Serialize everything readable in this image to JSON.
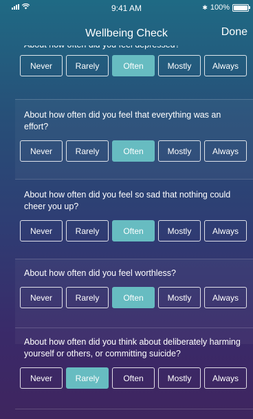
{
  "status_bar": {
    "time": "9:41 AM",
    "battery_text": "100%",
    "bluetooth_symbol": "✱"
  },
  "nav": {
    "title": "Wellbeing Check",
    "done_label": "Done"
  },
  "options": [
    "Never",
    "Rarely",
    "Often",
    "Mostly",
    "Always"
  ],
  "questions": [
    {
      "text": "About how often did you feel depressed?",
      "selected": "Often"
    },
    {
      "text": "About how often did you feel that everything was an effort?",
      "selected": "Often"
    },
    {
      "text": "About how often did you feel so sad that nothing could cheer you up?",
      "selected": "Often"
    },
    {
      "text": "About how often did you feel worthless?",
      "selected": "Often"
    },
    {
      "text": "About how often did you think about deliberately harming yourself or others, or committing suicide?",
      "selected": "Rarely"
    }
  ],
  "colors": {
    "selected_fill": "#67bcc1",
    "gradient_top": "#1f6a84",
    "gradient_bottom": "#3f255f"
  }
}
